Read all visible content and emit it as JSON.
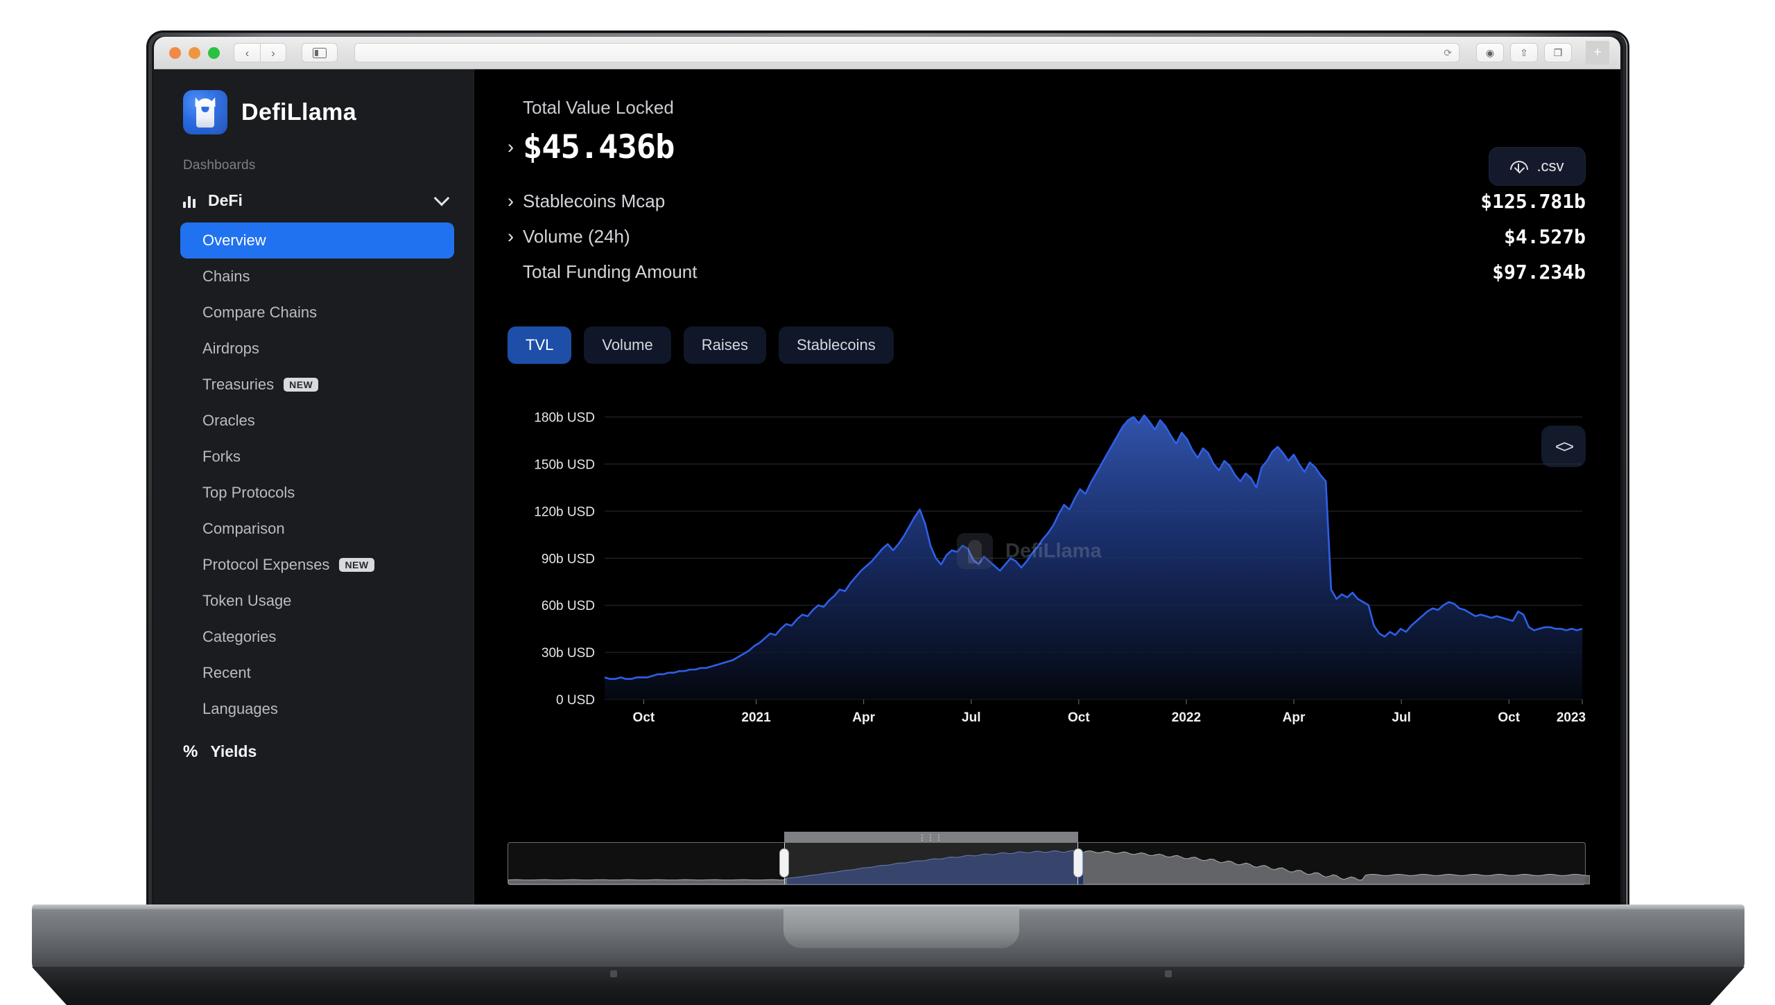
{
  "browser": {
    "traffic_lights": [
      "close",
      "minimize",
      "maximize"
    ],
    "back_label": "‹",
    "forward_label": "›",
    "url_value": "",
    "url_placeholder": "",
    "reload_label": "⟳",
    "toolbar_icons": [
      "record-icon",
      "share-icon",
      "tabs-icon"
    ],
    "new_tab_label": "+"
  },
  "sidebar": {
    "brand": "DefiLlama",
    "dashboards_label": "Dashboards",
    "sections": [
      {
        "label": "DeFi",
        "icon": "bar-chart-icon",
        "expanded": true
      },
      {
        "label": "Yields",
        "icon": "percent-icon",
        "expanded": false
      }
    ],
    "items": [
      {
        "label": "Overview",
        "active": true,
        "badge": ""
      },
      {
        "label": "Chains",
        "active": false,
        "badge": ""
      },
      {
        "label": "Compare Chains",
        "active": false,
        "badge": ""
      },
      {
        "label": "Airdrops",
        "active": false,
        "badge": ""
      },
      {
        "label": "Treasuries",
        "active": false,
        "badge": "NEW"
      },
      {
        "label": "Oracles",
        "active": false,
        "badge": ""
      },
      {
        "label": "Forks",
        "active": false,
        "badge": ""
      },
      {
        "label": "Top Protocols",
        "active": false,
        "badge": ""
      },
      {
        "label": "Comparison",
        "active": false,
        "badge": ""
      },
      {
        "label": "Protocol Expenses",
        "active": false,
        "badge": "NEW"
      },
      {
        "label": "Token Usage",
        "active": false,
        "badge": ""
      },
      {
        "label": "Categories",
        "active": false,
        "badge": ""
      },
      {
        "label": "Recent",
        "active": false,
        "badge": ""
      },
      {
        "label": "Languages",
        "active": false,
        "badge": ""
      }
    ]
  },
  "main": {
    "tvl_caption": "Total Value Locked",
    "tvl_value": "$45.436b",
    "csv_label": ".csv",
    "stats": [
      {
        "label": "Stablecoins Mcap",
        "value": "$125.781b",
        "expandable": true
      },
      {
        "label": "Volume (24h)",
        "value": "$4.527b",
        "expandable": true
      },
      {
        "label": "Total Funding Amount",
        "value": "$97.234b",
        "expandable": false
      }
    ],
    "tabs": [
      {
        "label": "TVL",
        "active": true
      },
      {
        "label": "Volume",
        "active": false
      },
      {
        "label": "Raises",
        "active": false
      },
      {
        "label": "Stablecoins",
        "active": false
      }
    ],
    "code_button_label": "<>",
    "watermark": "DefiLlama",
    "range_handle_label": "⋮⋮⋮"
  },
  "chart_data": {
    "type": "area",
    "title": "Total Value Locked",
    "xlabel": "",
    "ylabel": "USD",
    "ylim": [
      0,
      190
    ],
    "grid": true,
    "legend": "none",
    "accent_color": "#2563eb",
    "area_fill_top": "#2c52a8",
    "area_fill_bottom": "#070c1c",
    "ytick_labels": [
      "180b USD",
      "150b USD",
      "120b USD",
      "90b USD",
      "60b USD",
      "30b USD",
      "0 USD"
    ],
    "ytick_values": [
      180,
      150,
      120,
      90,
      60,
      30,
      0
    ],
    "xtick_labels": [
      "Oct",
      "2021",
      "Apr",
      "Jul",
      "Oct",
      "2022",
      "Apr",
      "Jul",
      "Oct",
      "2023"
    ],
    "xtick_positions": [
      0.04,
      0.155,
      0.265,
      0.375,
      0.485,
      0.595,
      0.705,
      0.815,
      0.925,
      1.0
    ],
    "series": [
      {
        "name": "TVL",
        "unit": "b USD",
        "values": [
          14,
          13,
          13,
          14,
          13,
          13,
          14,
          14,
          14,
          15,
          16,
          16,
          17,
          17,
          18,
          18,
          19,
          19,
          20,
          20,
          21,
          22,
          23,
          24,
          25,
          27,
          29,
          31,
          34,
          36,
          39,
          42,
          41,
          45,
          48,
          47,
          51,
          54,
          53,
          57,
          60,
          59,
          63,
          66,
          70,
          69,
          74,
          78,
          82,
          85,
          88,
          92,
          96,
          99,
          95,
          99,
          104,
          110,
          116,
          121,
          112,
          98,
          90,
          86,
          92,
          95,
          94,
          98,
          96,
          89,
          86,
          91,
          88,
          85,
          82,
          86,
          90,
          88,
          84,
          88,
          93,
          97,
          102,
          106,
          111,
          118,
          124,
          121,
          128,
          134,
          131,
          138,
          144,
          150,
          156,
          162,
          168,
          174,
          178,
          180,
          176,
          181,
          177,
          172,
          178,
          174,
          168,
          163,
          170,
          166,
          159,
          154,
          160,
          157,
          150,
          146,
          152,
          149,
          143,
          139,
          144,
          141,
          135,
          148,
          152,
          158,
          161,
          157,
          152,
          156,
          150,
          145,
          151,
          148,
          143,
          139,
          70,
          64,
          67,
          65,
          68,
          64,
          62,
          60,
          47,
          42,
          40,
          43,
          41,
          45,
          43,
          47,
          50,
          53,
          56,
          58,
          57,
          60,
          62,
          61,
          58,
          57,
          55,
          53,
          54,
          53,
          52,
          53,
          52,
          51,
          50,
          56,
          54,
          46,
          44,
          45,
          46,
          46,
          45,
          45,
          44,
          45,
          44,
          45
        ]
      }
    ]
  }
}
